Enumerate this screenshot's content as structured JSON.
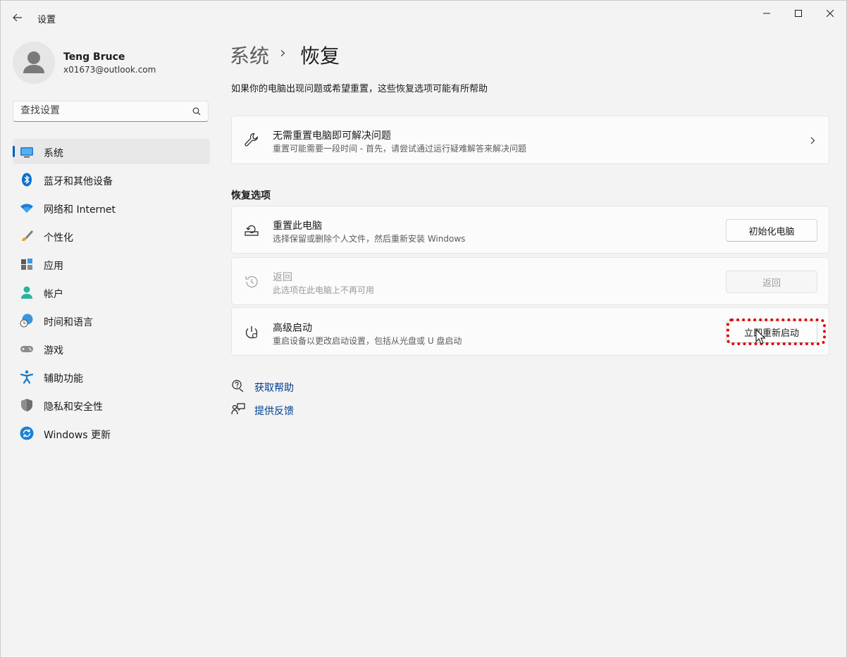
{
  "window": {
    "title": "设置"
  },
  "user": {
    "name": "Teng Bruce",
    "email": "x01673@outlook.com"
  },
  "search": {
    "placeholder": "查找设置"
  },
  "sidebar": {
    "items": [
      {
        "label": "系统",
        "icon": "system-icon",
        "active": true
      },
      {
        "label": "蓝牙和其他设备",
        "icon": "bluetooth-icon"
      },
      {
        "label": "网络和 Internet",
        "icon": "wifi-icon"
      },
      {
        "label": "个性化",
        "icon": "brush-icon"
      },
      {
        "label": "应用",
        "icon": "apps-icon"
      },
      {
        "label": "帐户",
        "icon": "account-icon"
      },
      {
        "label": "时间和语言",
        "icon": "globe-clock-icon"
      },
      {
        "label": "游戏",
        "icon": "gamepad-icon"
      },
      {
        "label": "辅助功能",
        "icon": "accessibility-icon"
      },
      {
        "label": "隐私和安全性",
        "icon": "shield-icon"
      },
      {
        "label": "Windows 更新",
        "icon": "update-icon"
      }
    ]
  },
  "breadcrumb": {
    "parent": "系统",
    "separator": "›",
    "current": "恢复"
  },
  "subtitle": "如果你的电脑出现问题或希望重置，这些恢复选项可能有所帮助",
  "troubleshoot": {
    "title": "无需重置电脑即可解决问题",
    "desc": "重置可能需要一段时间 - 首先，请尝试通过运行疑难解答来解决问题"
  },
  "recovery": {
    "section_label": "恢复选项",
    "reset": {
      "title": "重置此电脑",
      "desc": "选择保留或删除个人文件，然后重新安装 Windows",
      "button": "初始化电脑"
    },
    "goback": {
      "title": "返回",
      "desc": "此选项在此电脑上不再可用",
      "button": "返回"
    },
    "advanced": {
      "title": "高级启动",
      "desc": "重启设备以更改启动设置，包括从光盘或 U 盘启动",
      "button": "立即重新启动"
    }
  },
  "links": {
    "help": "获取帮助",
    "feedback": "提供反馈"
  },
  "colors": {
    "accent": "#005fb8",
    "link": "#003e92",
    "highlight": "#e00000"
  }
}
